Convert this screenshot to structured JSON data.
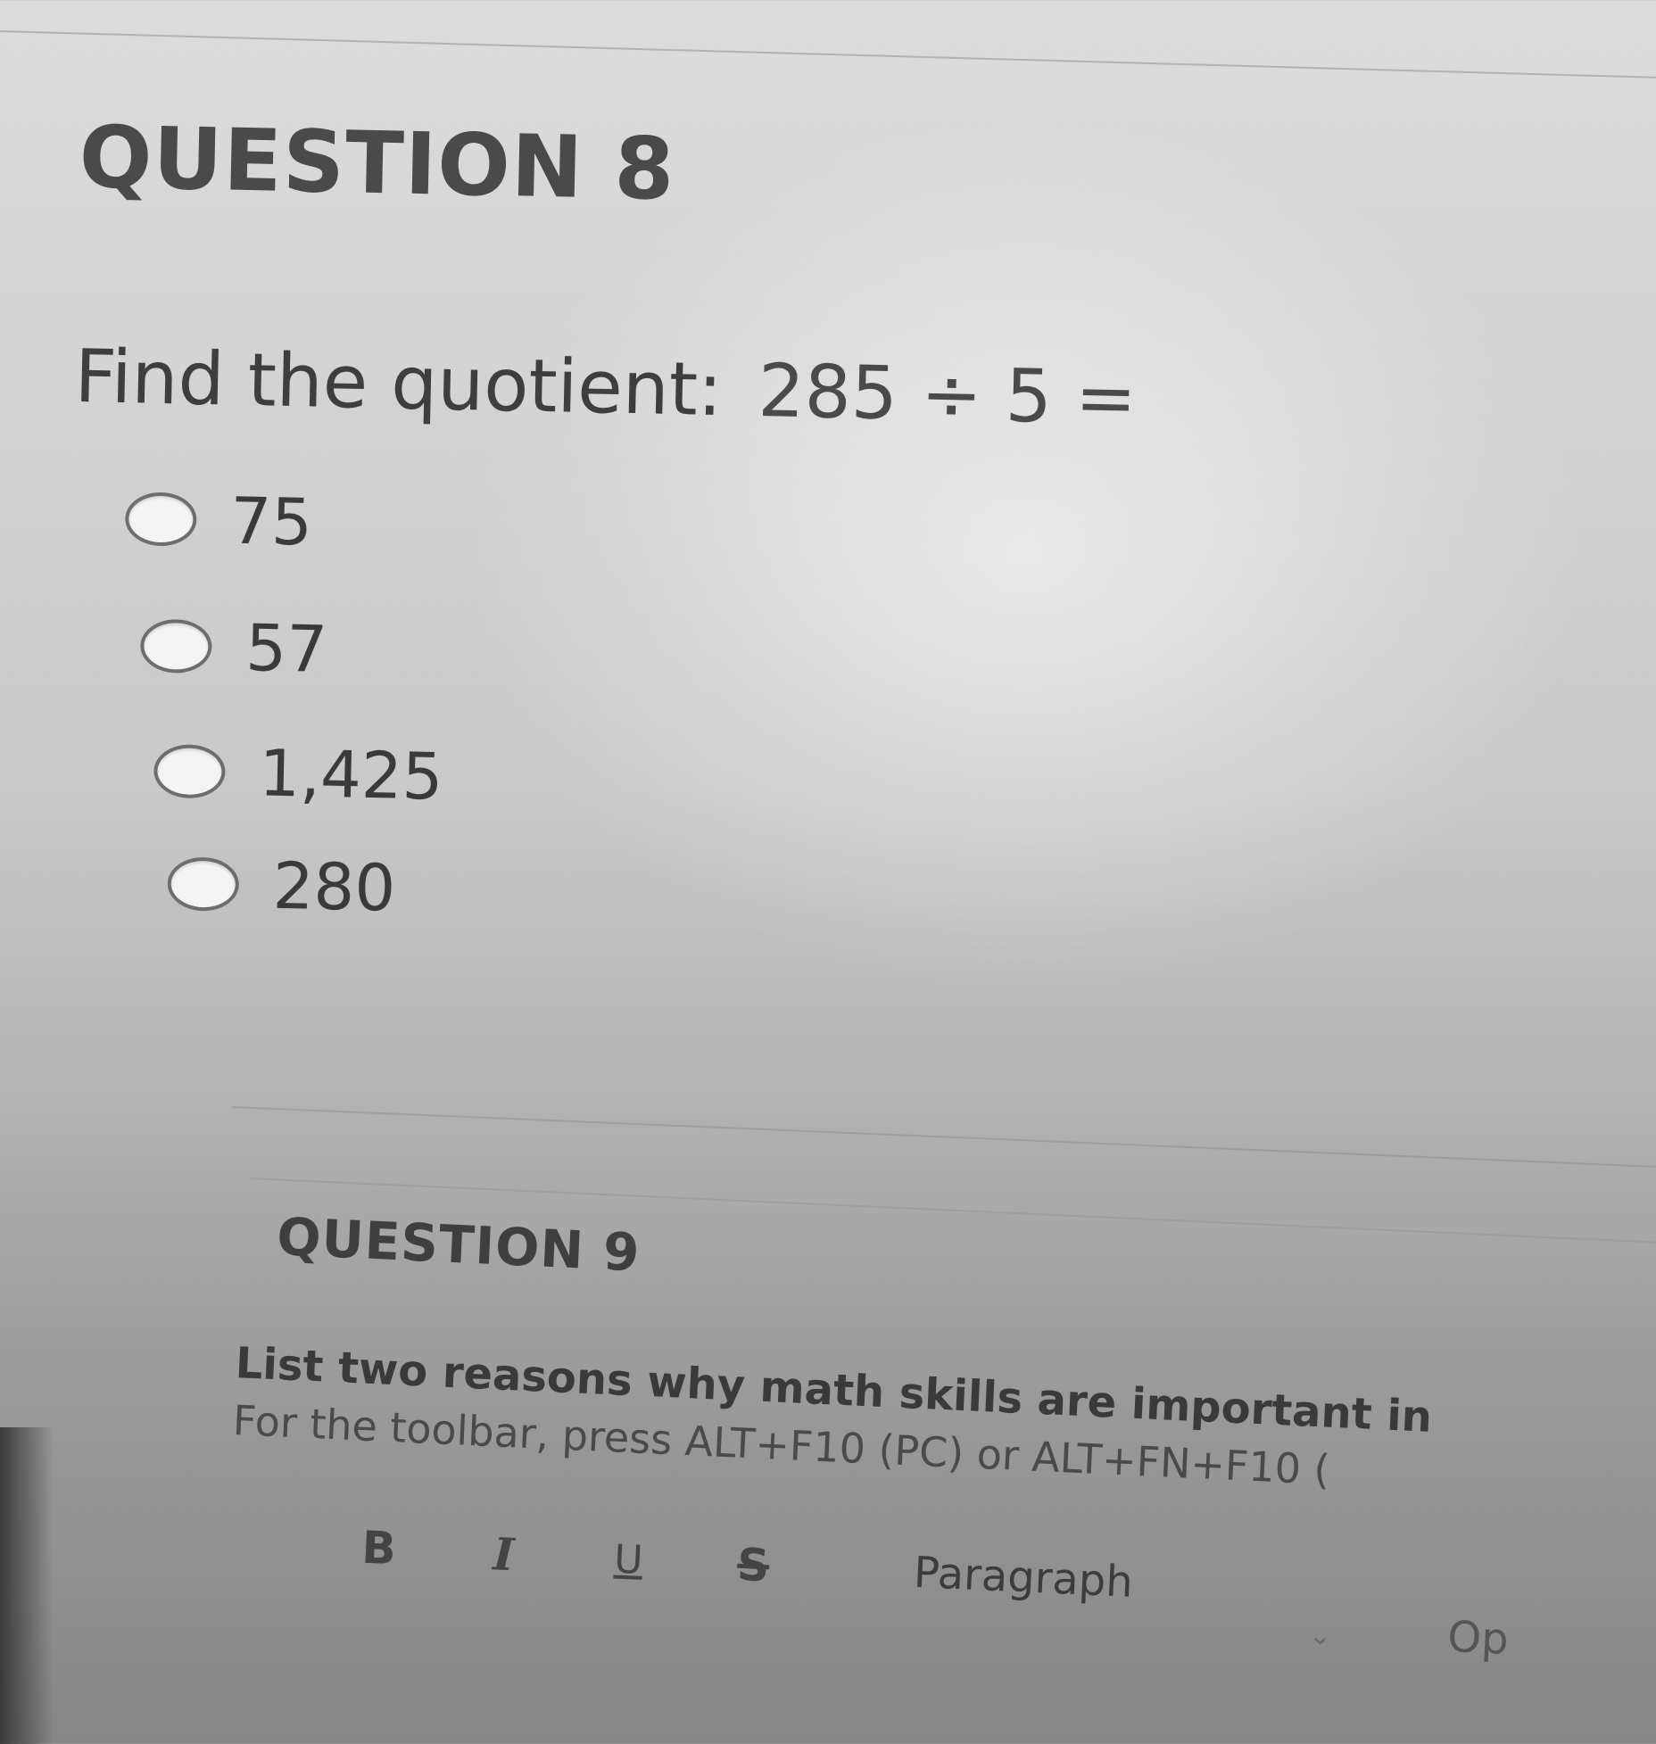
{
  "question8": {
    "heading": "QUESTION 8",
    "prompt": "Find the quotient:",
    "expression": "285 ÷ 5 =",
    "options": [
      "75",
      "57",
      "1,425",
      "280"
    ]
  },
  "question9": {
    "heading": "QUESTION 9",
    "prompt": "List two reasons why math skills are important in",
    "toolbar_hint": "For the toolbar, press ALT+F10 (PC) or ALT+FN+F10 (",
    "toolbar": {
      "bold": "B",
      "italic": "I",
      "underline": "U",
      "strikethrough": "S",
      "paragraph": "Paragraph",
      "chevron": "⌄",
      "more": "Op"
    }
  }
}
